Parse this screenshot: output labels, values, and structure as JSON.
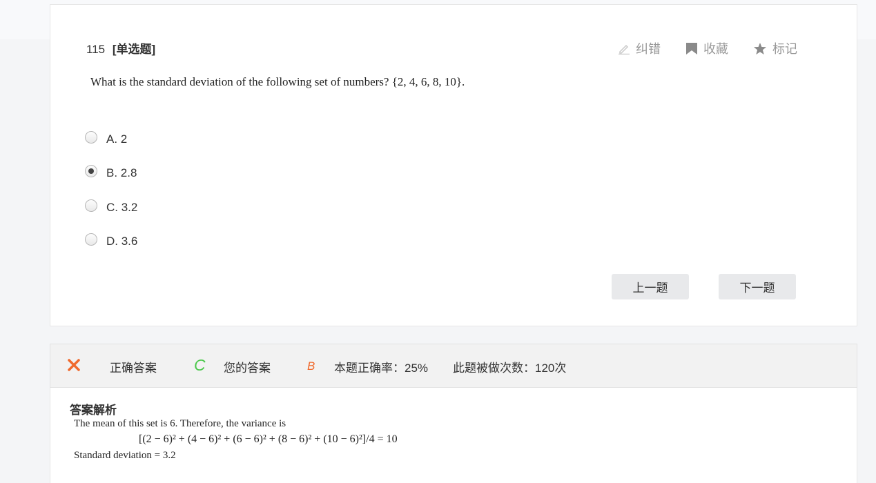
{
  "question": {
    "number": "115",
    "type": "[单选题]",
    "stem": "What is the standard deviation of the following set of numbers?  {2, 4, 6, 8, 10}.",
    "options": [
      {
        "label": "A. 2",
        "checked": false
      },
      {
        "label": "B. 2.8",
        "checked": true
      },
      {
        "label": "C. 3.2",
        "checked": false
      },
      {
        "label": "D. 3.6",
        "checked": false
      }
    ]
  },
  "tools": {
    "correct_label": "纠错",
    "correct_icon": "pencil-icon",
    "favorite_label": "收藏",
    "favorite_icon": "bookmark-icon",
    "mark_label": "标记",
    "mark_icon": "star-icon"
  },
  "nav": {
    "prev_label": "上一题",
    "next_label": "下一题"
  },
  "result": {
    "status_icon": "x-mark-icon",
    "correct_answer_label": "正确答案",
    "correct_answer": "C",
    "your_answer_label": "您的答案",
    "your_answer": "B",
    "accuracy_text": "本题正确率：25%",
    "attempts_text": "此题被做次数：120次",
    "colors": {
      "wrong": "#f06a2d",
      "correct": "#4cc84c"
    }
  },
  "analysis": {
    "title": "答案解析",
    "line1": "The mean of this set is 6. Therefore, the variance is",
    "line2": "[(2 − 6)² + (4 − 6)² + (6 − 6)² + (8 − 6)² + (10 − 6)²]/4 = 10",
    "line3": "Standard deviation = 3.2"
  }
}
